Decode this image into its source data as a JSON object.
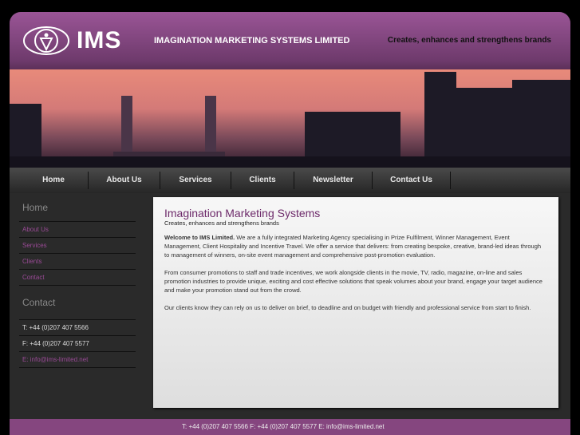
{
  "header": {
    "logo_text": "IMS",
    "company_name": "IMAGINATION MARKETING SYSTEMS LIMITED",
    "tagline": "Creates, enhances and strengthens brands"
  },
  "nav": [
    "Home",
    "About Us",
    "Services",
    "Clients",
    "Newsletter",
    "Contact Us"
  ],
  "sidebar": {
    "menu_heading": "Home",
    "links": [
      "About Us",
      "Services",
      "Clients",
      "Contact"
    ],
    "contact_heading": "Contact",
    "phone": "T: +44 (0)207 407 5566",
    "fax": "F: +44 (0)207 407 5577",
    "email": "E: info@ims-limited.net"
  },
  "content": {
    "title": "Imagination Marketing Systems",
    "subtitle": "Creates, enhances and strengthens brands",
    "intro_bold": "Welcome to IMS Limited.",
    "p1": " We are a fully integrated Marketing Agency specialising in Prize Fulfilment, Winner Management, Event Management, Client Hospitality and Incentive Travel. We offer a service that delivers: from creating bespoke, creative, brand-led ideas through to management of winners, on-site event management and comprehensive post-promotion evaluation.",
    "p2": "From consumer promotions to staff and trade incentives, we work alongside clients in the movie, TV, radio, magazine, on-line and sales promotion industries to provide unique, exciting and cost effective solutions that speak volumes about your brand, engage your target audience and make your promotion stand out from the crowd.",
    "p3": "Our clients know they can rely on us to deliver on brief, to deadline and on budget with friendly and professional service from start to finish."
  },
  "footer": {
    "text": "T: +44 (0)207 407 5566 F: +44 (0)207 407 5577 E: info@ims-limited.net"
  }
}
